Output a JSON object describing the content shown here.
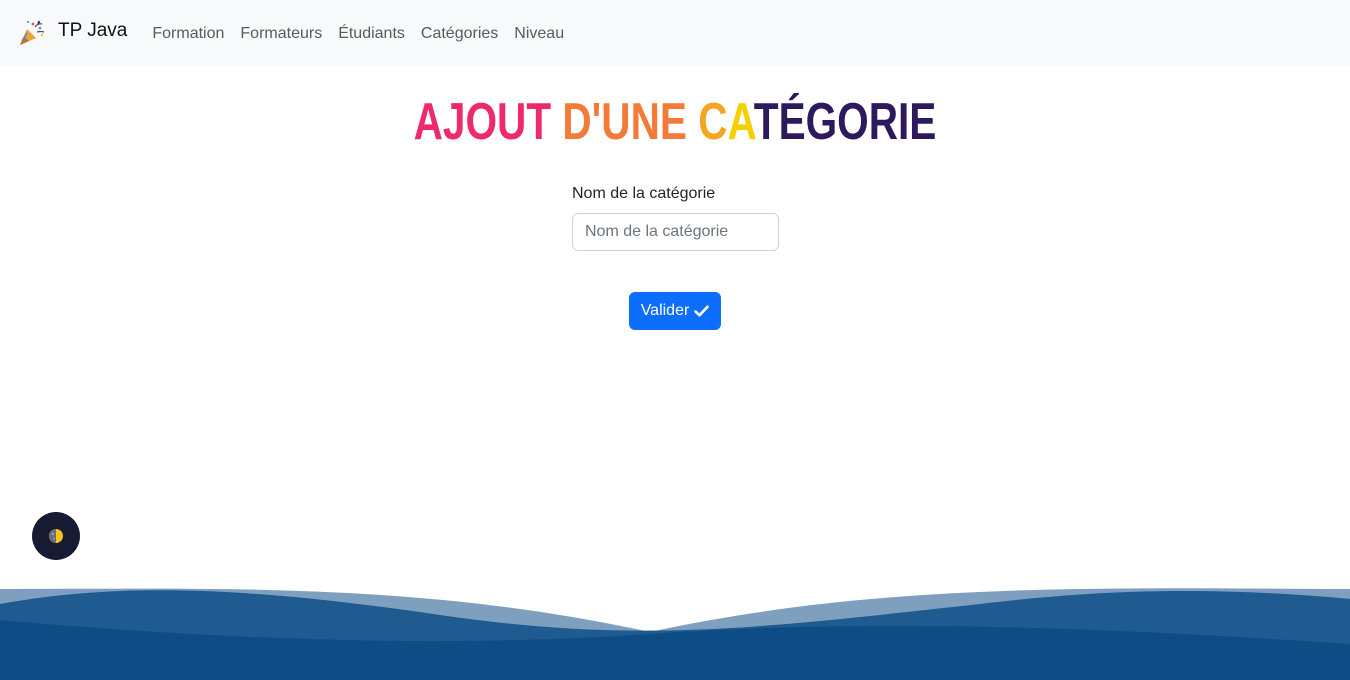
{
  "navbar": {
    "brand_icon": "party-popper-icon",
    "brand": "TP Java",
    "links": [
      "Formation",
      "Formateurs",
      "Étudiants",
      "Catégories",
      "Niveau"
    ]
  },
  "page": {
    "title_parts": [
      {
        "text": "AJOUT ",
        "color": "#ee2a6b"
      },
      {
        "text": "D'UNE ",
        "color": "#f47a3a"
      },
      {
        "text": "C",
        "color": "#f4a623"
      },
      {
        "text": "A",
        "color": "#f4d000"
      },
      {
        "text": "TÉGORIE",
        "color": "#2d1a5c"
      }
    ]
  },
  "form": {
    "label": "Nom de la catégorie",
    "placeholder": "Nom de la catégorie",
    "value": "",
    "submit_label": "Valider",
    "submit_icon": "check-icon"
  },
  "theme_toggle": {
    "icon": "half-moon-icon"
  },
  "colors": {
    "navbar_bg": "#f8f9fa",
    "primary": "#0d6efd",
    "wave_light": "#7f9fbf",
    "wave_mid": "#1f5a91",
    "wave_dark": "#0e4c85"
  }
}
